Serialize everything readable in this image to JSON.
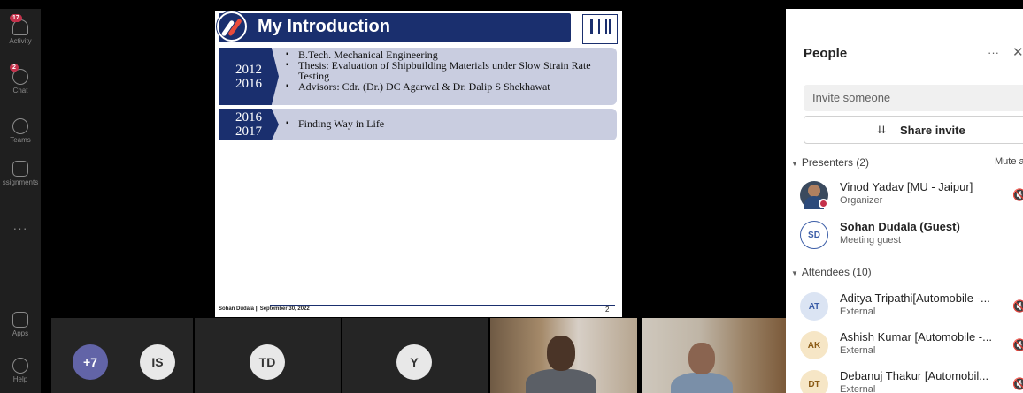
{
  "rail": {
    "items": [
      {
        "label": "Activity",
        "badge": "17",
        "icon": "bell-icon"
      },
      {
        "label": "Chat",
        "badge": "2",
        "icon": "chat-icon"
      },
      {
        "label": "Teams",
        "badge": "",
        "icon": "teams-icon"
      },
      {
        "label": "ssignments",
        "badge": "",
        "icon": "assignments-icon"
      },
      {
        "label": "Apps",
        "badge": "",
        "icon": "apps-icon"
      },
      {
        "label": "Help",
        "badge": "",
        "icon": "help-icon"
      }
    ],
    "more": "···"
  },
  "slide": {
    "title": "My Introduction",
    "rows": [
      {
        "years": [
          "2012",
          "2016"
        ],
        "bullets": [
          "B.Tech. Mechanical Engineering",
          "Thesis: Evaluation of Shipbuilding Materials under Slow Strain Rate Testing",
          "Advisors: Cdr. (Dr.) DC Agarwal & Dr. Dalip S Shekhawat"
        ]
      },
      {
        "years": [
          "2016",
          "2017"
        ],
        "bullets": [
          "Finding Way in Life"
        ]
      }
    ],
    "footer": "Sohan Dudala || September 30, 2022",
    "page": "2"
  },
  "strip": {
    "tiles": [
      {
        "initials": "+7",
        "color": "#6264a7"
      },
      {
        "initials": "IS",
        "color": "#e8e8e8"
      },
      {
        "initials": "TD",
        "color": "#e8e8e8"
      },
      {
        "initials": "Y",
        "color": "#e8e8e8"
      }
    ]
  },
  "panel": {
    "title": "People",
    "more": "···",
    "close": "✕",
    "invite_placeholder": "Invite someone",
    "share_label": "Share invite",
    "presenters_header": "Presenters (2)",
    "mute_all": "Mute a",
    "presenters": [
      {
        "name": "Vinod Yadav [MU - Jaipur]",
        "sub": "Organizer",
        "initials": "",
        "bold": false
      },
      {
        "name": "Sohan Dudala (Guest)",
        "sub": "Meeting guest",
        "initials": "SD",
        "bold": true
      }
    ],
    "attendees_header": "Attendees (10)",
    "attendees": [
      {
        "name": "Aditya Tripathi[Automobile -...",
        "sub": "External",
        "initials": "AT",
        "bg": "#dbe4f3",
        "fg": "#3b5da7"
      },
      {
        "name": "Ashish Kumar [Automobile -...",
        "sub": "External",
        "initials": "AK",
        "bg": "#f6e6c6",
        "fg": "#8a5a14"
      },
      {
        "name": "Debanuj Thakur [Automobil...",
        "sub": "External",
        "initials": "DT",
        "bg": "#f6e6c6",
        "fg": "#8a5a14"
      }
    ]
  }
}
